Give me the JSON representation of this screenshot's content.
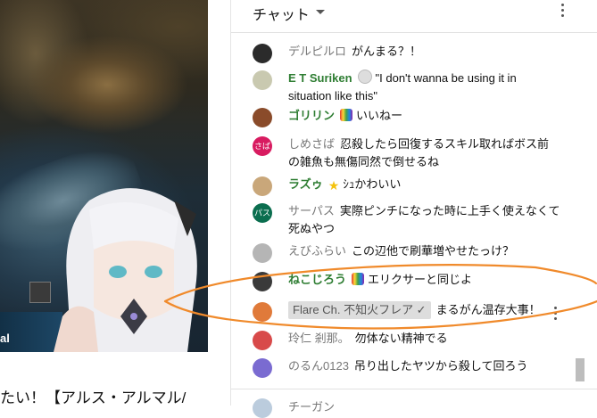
{
  "video": {
    "side_label": "al",
    "title": "たい！【アルス・アルマル/"
  },
  "chat": {
    "header_title": "チャット",
    "messages": [
      {
        "name": "デルピルロ",
        "member": false,
        "badge": "",
        "text": "がんまる？！",
        "avatar_color": "#2b2b2b",
        "avatar_text": ""
      },
      {
        "name": "E T Suriken",
        "member": true,
        "badge": "chibi",
        "text": "\"I don't wanna be using it in situation like this\"",
        "avatar_color": "#c9c9b0",
        "avatar_text": ""
      },
      {
        "name": "ゴリリン",
        "member": true,
        "badge": "rainbow",
        "text": "いいねー",
        "avatar_color": "#8a4b2a",
        "avatar_text": ""
      },
      {
        "name": "しめさば",
        "member": false,
        "badge": "",
        "text": "忍殺したら回復するスキル取ればボス前の雑魚も無傷同然で倒せるね",
        "avatar_color": "#d81b60",
        "avatar_text": "さば"
      },
      {
        "name": "ラズゥ",
        "member": true,
        "badge": "star",
        "text": "ｼｭかわいい",
        "avatar_color": "#c9a77a",
        "avatar_text": ""
      },
      {
        "name": "サーパス",
        "member": false,
        "badge": "",
        "text": "実際ピンチになった時に上手く使えなくて死ぬやつ",
        "avatar_color": "#0b6e4f",
        "avatar_text": "パス"
      },
      {
        "name": "えびふらい",
        "member": false,
        "badge": "",
        "text": "この辺他で刷華増やせたっけ？",
        "avatar_color": "#b5b5b5",
        "avatar_text": ""
      },
      {
        "name": "ねこじろう",
        "member": true,
        "badge": "rainbow",
        "text": "エリクサーと同じよ",
        "avatar_color": "#3a3a3a",
        "avatar_text": ""
      },
      {
        "name": "Flare Ch. 不知火フレア ✓",
        "member": false,
        "badge": "owner",
        "text": "まるがん温存大事！",
        "avatar_color": "#e07a3a",
        "avatar_text": ""
      },
      {
        "name": "玲仁 剎那。",
        "member": false,
        "badge": "",
        "text": "勿体ない精神でる",
        "avatar_color": "#d84a4a",
        "avatar_text": ""
      },
      {
        "name": "のるん0123",
        "member": false,
        "badge": "",
        "text": "吊り出したヤツから殺して回ろう",
        "avatar_color": "#7a6bd1",
        "avatar_text": ""
      }
    ],
    "footer_name": "チーガン"
  },
  "colors": {
    "member_name": "#2e7d32",
    "annotation": "#f08a2b"
  }
}
